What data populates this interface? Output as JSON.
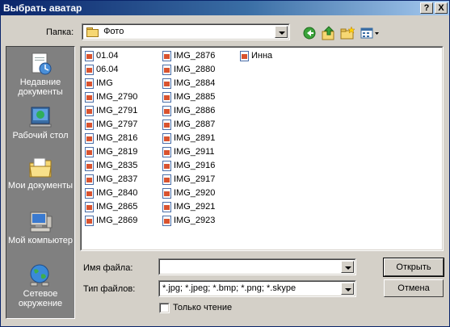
{
  "window": {
    "title": "Выбрать аватар",
    "help_glyph": "?",
    "close_glyph": "X"
  },
  "lookin": {
    "label": "Папка:",
    "value": "Фото"
  },
  "places": [
    {
      "name": "recent",
      "label": "Недавние документы"
    },
    {
      "name": "desktop",
      "label": "Рабочий стол"
    },
    {
      "name": "mydocs",
      "label": "Мои документы"
    },
    {
      "name": "mycomp",
      "label": "Мой компьютер"
    },
    {
      "name": "network",
      "label": "Сетевое окружение"
    }
  ],
  "files": {
    "col1": [
      {
        "name": "01.04",
        "kind": "folder"
      },
      {
        "name": "06.04",
        "kind": "folder"
      },
      {
        "name": "IMG",
        "kind": "folder"
      },
      {
        "name": "IMG_2790",
        "kind": "image"
      },
      {
        "name": "IMG_2791",
        "kind": "image"
      },
      {
        "name": "IMG_2797",
        "kind": "image"
      },
      {
        "name": "IMG_2816",
        "kind": "image"
      },
      {
        "name": "IMG_2819",
        "kind": "image"
      },
      {
        "name": "IMG_2835",
        "kind": "image"
      },
      {
        "name": "IMG_2837",
        "kind": "image"
      },
      {
        "name": "IMG_2840",
        "kind": "image"
      },
      {
        "name": "IMG_2865",
        "kind": "image"
      },
      {
        "name": "IMG_2869",
        "kind": "image"
      }
    ],
    "col2": [
      {
        "name": "IMG_2876",
        "kind": "image"
      },
      {
        "name": "IMG_2880",
        "kind": "image"
      },
      {
        "name": "IMG_2884",
        "kind": "image"
      },
      {
        "name": "IMG_2885",
        "kind": "image"
      },
      {
        "name": "IMG_2886",
        "kind": "image"
      },
      {
        "name": "IMG_2887",
        "kind": "image"
      },
      {
        "name": "IMG_2891",
        "kind": "image"
      },
      {
        "name": "IMG_2911",
        "kind": "image"
      },
      {
        "name": "IMG_2916",
        "kind": "image"
      },
      {
        "name": "IMG_2917",
        "kind": "image"
      },
      {
        "name": "IMG_2920",
        "kind": "image"
      },
      {
        "name": "IMG_2921",
        "kind": "image"
      },
      {
        "name": "IMG_2923",
        "kind": "image"
      }
    ],
    "col3": [
      {
        "name": "Инна",
        "kind": "image"
      }
    ]
  },
  "filename": {
    "label": "Имя файла:",
    "value": ""
  },
  "filetype": {
    "label": "Тип файлов:",
    "value": "*.jpg; *.jpeg; *.bmp; *.png; *.skype"
  },
  "readonly": {
    "label": "Только чтение",
    "checked": false
  },
  "buttons": {
    "open": "Открыть",
    "cancel": "Отмена"
  }
}
